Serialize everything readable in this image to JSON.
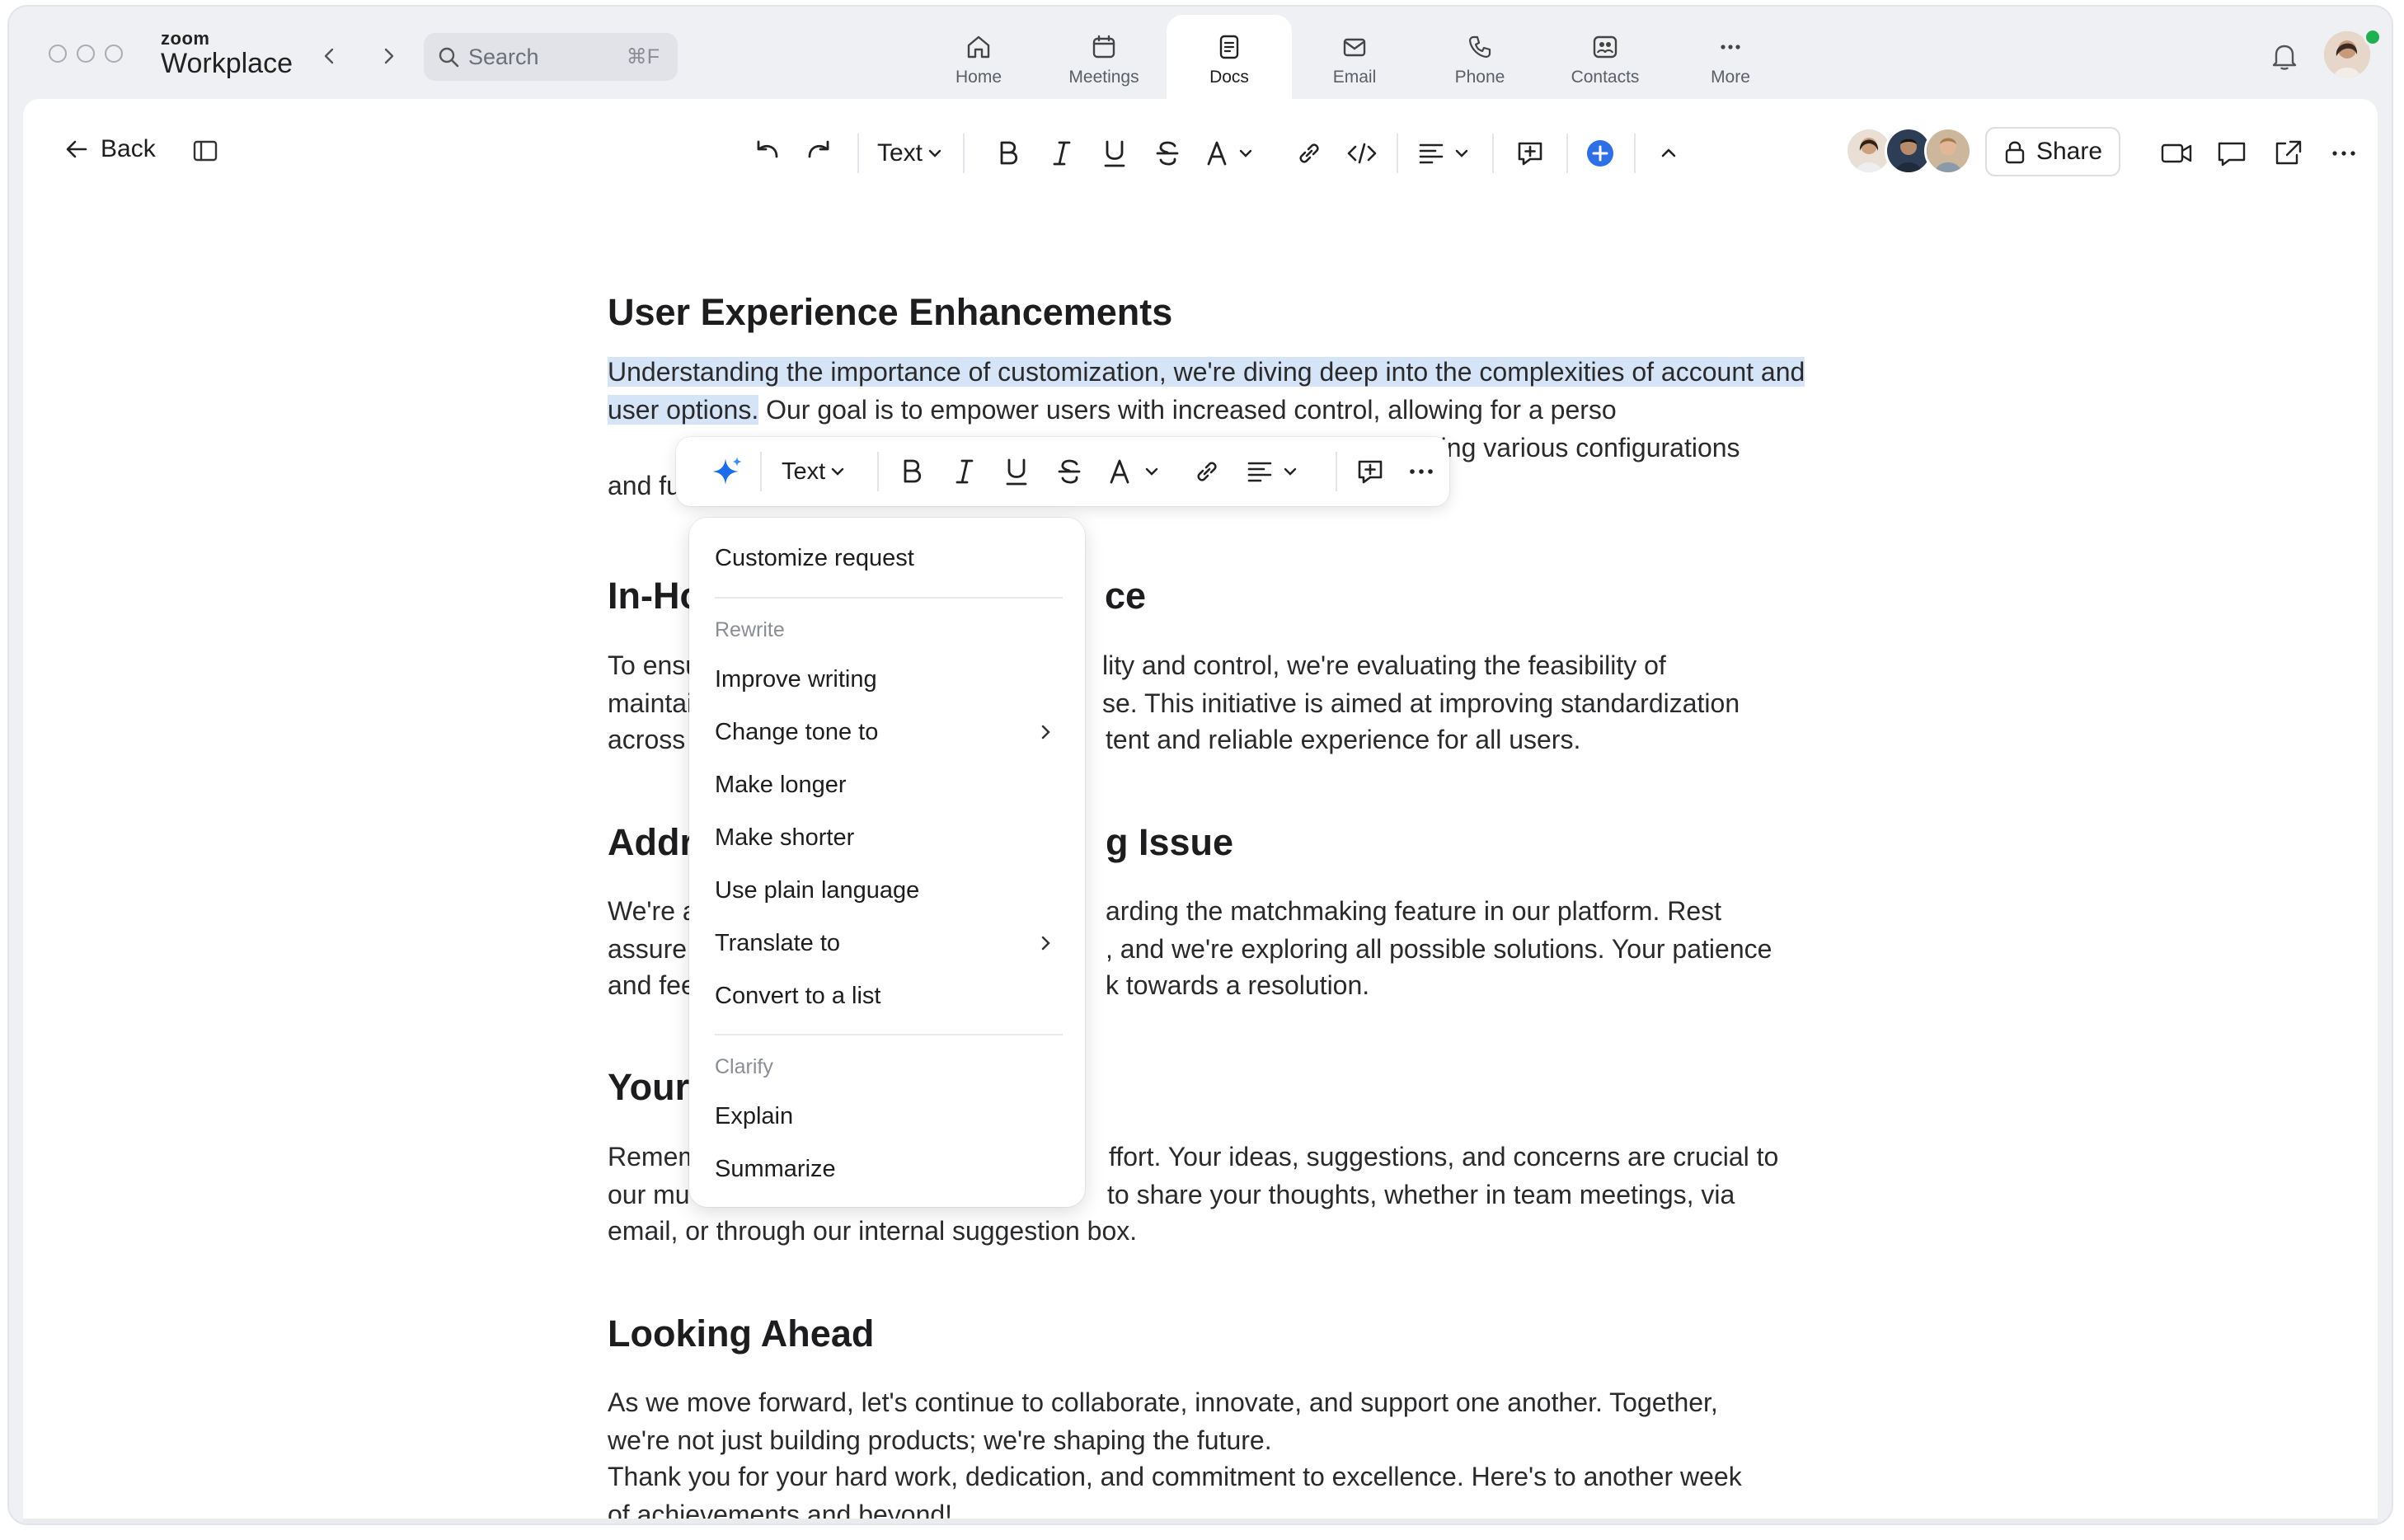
{
  "app": {
    "brand_small": "zoom",
    "brand_big": "Workplace",
    "search_placeholder": "Search",
    "search_shortcut": "⌘F"
  },
  "nav_tabs": [
    {
      "label": "Home",
      "icon": "home-icon"
    },
    {
      "label": "Meetings",
      "icon": "calendar-icon"
    },
    {
      "label": "Docs",
      "icon": "document-icon",
      "active": true
    },
    {
      "label": "Email",
      "icon": "mail-icon"
    },
    {
      "label": "Phone",
      "icon": "phone-icon"
    },
    {
      "label": "Contacts",
      "icon": "contacts-icon"
    },
    {
      "label": "More",
      "icon": "more-icon"
    }
  ],
  "editor": {
    "back_label": "Back",
    "text_style": "Text",
    "share_label": "Share"
  },
  "document": {
    "sections": [
      {
        "heading": "User Experience Enhancements",
        "body_selected": "Understanding the importance of customization, we're diving deep into the complexities of account and user options.",
        "body_rest": " Our goal is to empower users with increased control, allowing for a perso",
        "body_rest_tail": "ring various configurations",
        "body_line4": "and fur"
      },
      {
        "heading_left": "In-Ho",
        "heading_right": "ce",
        "line1_left": "To ensu",
        "line1_right": "lity and control, we're evaluating the feasibility of",
        "line2_left": "maintai",
        "line2_right": "se. This initiative is aimed at improving standardization",
        "line3_left": "across",
        "line3_right": "tent and reliable experience for all users."
      },
      {
        "heading_left": "Addr",
        "heading_right": "g Issue",
        "line1_left": "We're a",
        "line1_right": "arding the matchmaking feature in our platform. Rest",
        "line2_left": "assure",
        "line2_right": ", and we're exploring all possible solutions. Your patience",
        "line3_left": "and fee",
        "line3_right": "k towards a resolution."
      },
      {
        "heading_left": "Your",
        "line1_left": "Remem",
        "line1_right": "ffort. Your ideas, suggestions, and concerns are crucial to",
        "line2_left": "our mu",
        "line2_right": "to share your thoughts, whether in team meetings, via",
        "line3": "email, or through our internal suggestion box."
      },
      {
        "heading": "Looking Ahead",
        "line1": "As we move forward, let's continue to collaborate, innovate, and support one another. Together,",
        "line2": "we're not just building products; we're shaping the future.",
        "line3": "Thank you for your hard work, dedication, and commitment to excellence. Here's to another week",
        "line4": "of achievements and beyond!"
      }
    ]
  },
  "floating_toolbar": {
    "text_style": "Text"
  },
  "ai_menu": {
    "customize": "Customize request",
    "rewrite_header": "Rewrite",
    "rewrite_items": [
      "Improve writing",
      "Change tone to",
      "Make longer",
      "Make shorter",
      "Use plain language",
      "Translate to",
      "Convert to a list"
    ],
    "clarify_header": "Clarify",
    "clarify_items": [
      "Explain",
      "Summarize"
    ]
  },
  "colors": {
    "selection": "#d6e4f7",
    "accent": "#0b5cff",
    "presence": "#1fb14f"
  }
}
